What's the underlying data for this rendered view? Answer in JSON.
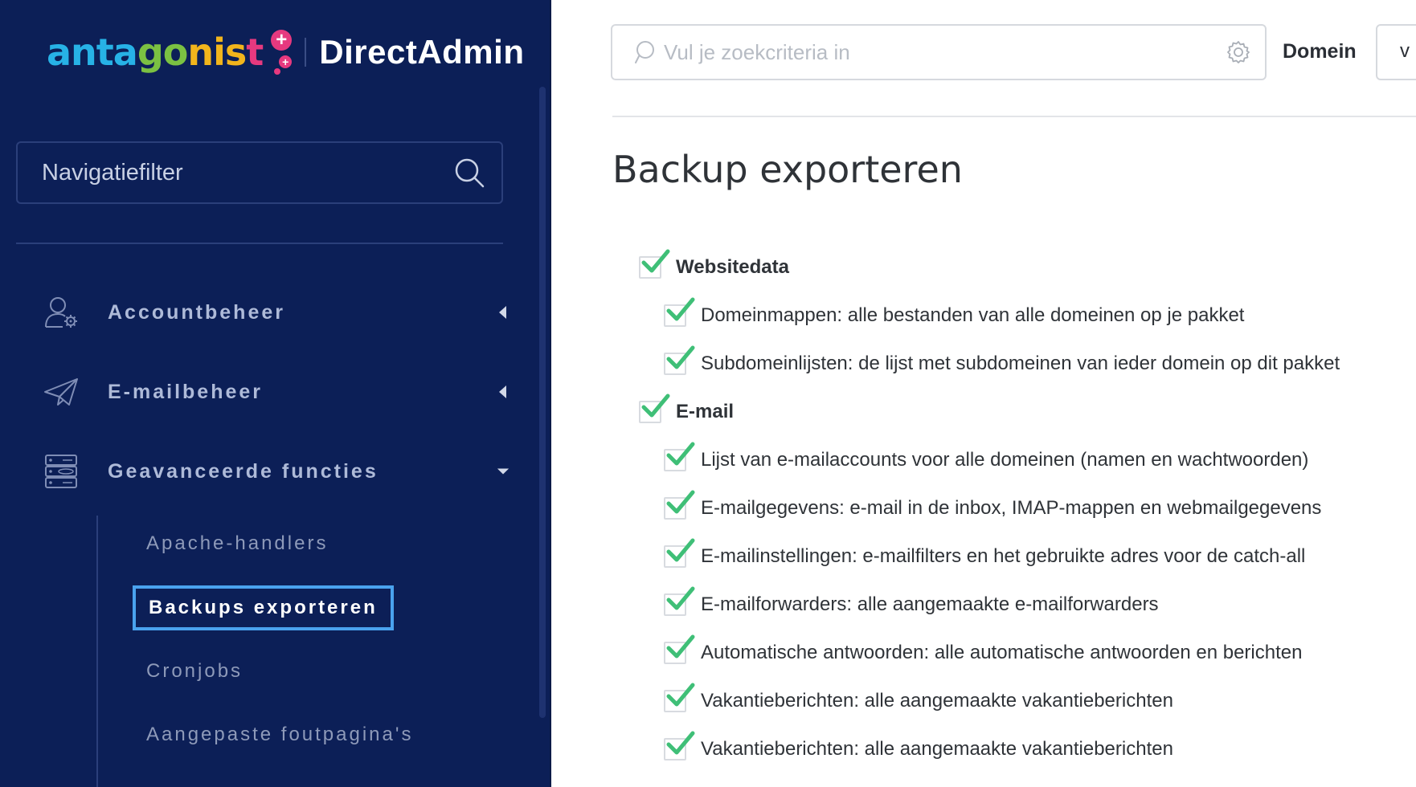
{
  "brand": {
    "antagonist": [
      "anta",
      "go",
      "nis",
      "t"
    ],
    "product": "DirectAdmin",
    "colors": {
      "blue": "#27b2e6",
      "green": "#7bc142",
      "yellow": "#f2b51c",
      "pink": "#e6397f"
    }
  },
  "sidebar": {
    "filter_placeholder": "Navigatiefilter",
    "items": [
      {
        "label": "Accountbeheer",
        "icon": "user-gear-icon",
        "state": "collapsed"
      },
      {
        "label": "E-mailbeheer",
        "icon": "paper-plane-icon",
        "state": "collapsed"
      },
      {
        "label": "Geavanceerde functies",
        "icon": "server-database-icon",
        "state": "expanded"
      }
    ],
    "sub_items": [
      {
        "label": "Apache-handlers",
        "active": false
      },
      {
        "label": "Backups exporteren",
        "active": true
      },
      {
        "label": "Cronjobs",
        "active": false
      },
      {
        "label": "Aangepaste foutpagina's",
        "active": false
      }
    ],
    "colors": {
      "background": "#0c1f57",
      "active_border": "#4aa2ee"
    }
  },
  "header": {
    "search_placeholder": "Vul je zoekcriteria in",
    "domain_label": "Domein",
    "domain_value": "v"
  },
  "page": {
    "title": "Backup exporteren",
    "options": [
      {
        "label": "Websitedata",
        "level": 0,
        "checked": true
      },
      {
        "label": "Domeinmappen: alle bestanden van alle domeinen op je pakket",
        "level": 1,
        "checked": true
      },
      {
        "label": "Subdomeinlijsten: de lijst met subdomeinen van ieder domein op dit pakket",
        "level": 1,
        "checked": true
      },
      {
        "label": "E-mail",
        "level": 0,
        "checked": true
      },
      {
        "label": "Lijst van e-mailaccounts voor alle domeinen (namen en wachtwoorden)",
        "level": 1,
        "checked": true
      },
      {
        "label": "E-mailgegevens: e-mail in de inbox, IMAP-mappen en webmailgegevens",
        "level": 1,
        "checked": true
      },
      {
        "label": "E-mailinstellingen: e-mailfilters en het gebruikte adres voor de catch-all",
        "level": 1,
        "checked": true
      },
      {
        "label": "E-mailforwarders: alle aangemaakte e-mailforwarders",
        "level": 1,
        "checked": true
      },
      {
        "label": "Automatische antwoorden: alle automatische antwoorden en berichten",
        "level": 1,
        "checked": true
      },
      {
        "label": "Vakantieberichten: alle aangemaakte vakantieberichten",
        "level": 1,
        "checked": true
      },
      {
        "label": "Vakantieberichten: alle aangemaakte vakantieberichten",
        "level": 1,
        "checked": true
      }
    ],
    "check_color": "#3fbf77"
  }
}
